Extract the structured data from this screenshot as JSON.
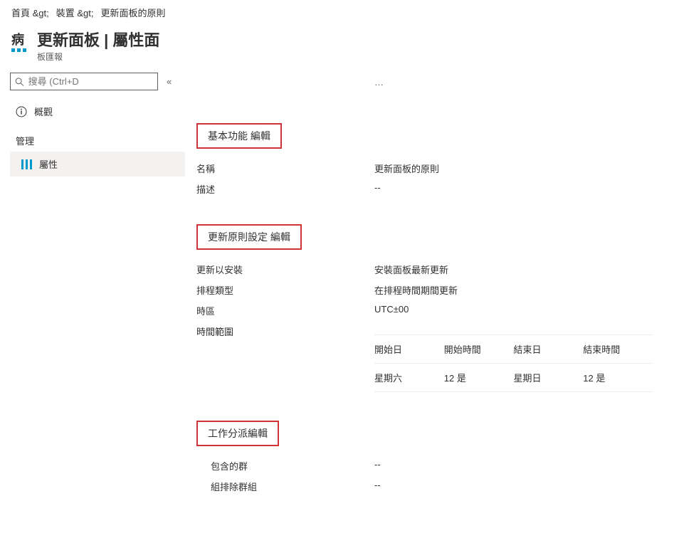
{
  "breadcrumb": {
    "home": "首頁 &gt;",
    "device": "裝置 &gt;",
    "policy": "更新面板的原則"
  },
  "header": {
    "pathogen": "病",
    "title": "更新面板 | 屬性面",
    "subtitle": "板匯報"
  },
  "search": {
    "placeholder": "搜尋 (Ctrl+D"
  },
  "sidebar": {
    "collapse": "«",
    "overview": "概觀",
    "manage": "管理",
    "properties": "屬性"
  },
  "ellipsis": "…",
  "basic": {
    "heading": "基本功能 編輯",
    "name_k": "名稱",
    "name_v": "更新面板的原則",
    "desc_k": "描述",
    "desc_v": "--"
  },
  "update": {
    "heading": "更新原則設定 編輯",
    "install_k": "更新以安裝",
    "install_v": "安裝面板最新更新",
    "schedtype_k": "排程類型",
    "schedtype_v": "在排程時間期間更新",
    "tz_k": "時區",
    "tz_v": "UTC±00",
    "range_k": "時間範圍",
    "col1": "開始日",
    "col2": "開始時間",
    "col3": "結束日",
    "col4": "結束時間",
    "r1c1": "星期六",
    "r1c2": "12 是",
    "r1c3": "星期日",
    "r1c4": "12 是"
  },
  "assign": {
    "heading": "工作分派編輯",
    "included_k": "包含的群",
    "included_v": "--",
    "excluded_k": "組排除群組",
    "excluded_v": "--"
  }
}
